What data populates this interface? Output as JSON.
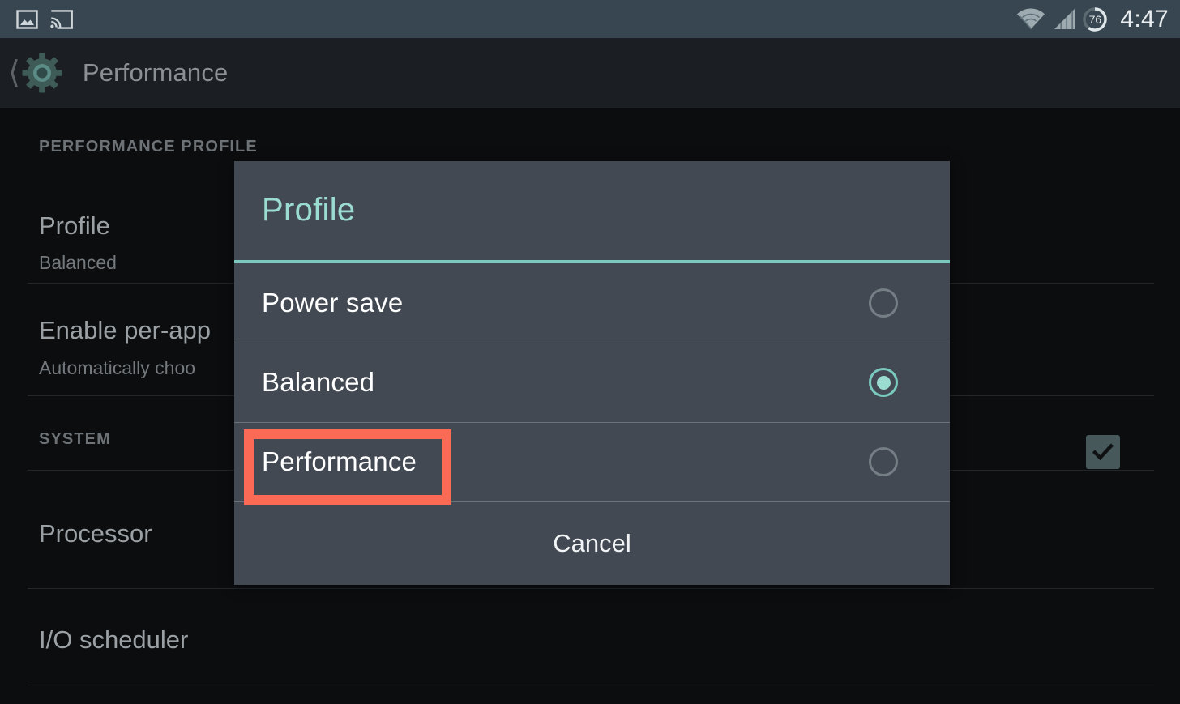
{
  "status_bar": {
    "icons": [
      "image-notification-icon",
      "cast-screen-icon",
      "wifi-icon",
      "cell-signal-icon",
      "battery-circle-icon"
    ],
    "battery_level": "76",
    "time": "4:47",
    "background": "#374650"
  },
  "action_bar": {
    "back_icon": "back-chevron-icon",
    "app_icon": "settings-gear-icon",
    "title": "Performance",
    "background": "#1b1e22"
  },
  "settings": {
    "sections": [
      {
        "header": "PERFORMANCE PROFILE",
        "rows": [
          {
            "title": "Profile",
            "subtitle": "Balanced",
            "control": "none"
          },
          {
            "title": "Enable per-app",
            "subtitle": "Automatically choo",
            "control": "checkbox",
            "checked": true
          }
        ]
      },
      {
        "header": "SYSTEM",
        "rows": [
          {
            "title": "Processor",
            "subtitle": "",
            "control": "none"
          },
          {
            "title": "I/O scheduler",
            "subtitle": "",
            "control": "none"
          }
        ]
      }
    ]
  },
  "dialog": {
    "title": "Profile",
    "title_color": "#9bdcd1",
    "accent_color": "#79c9bf",
    "background": "#424952",
    "options": [
      {
        "label": "Power save",
        "selected": false
      },
      {
        "label": "Balanced",
        "selected": true
      },
      {
        "label": "Performance",
        "selected": false
      }
    ],
    "cancel_label": "Cancel"
  },
  "annotation": {
    "target": "Performance",
    "color": "#fb6a55"
  }
}
